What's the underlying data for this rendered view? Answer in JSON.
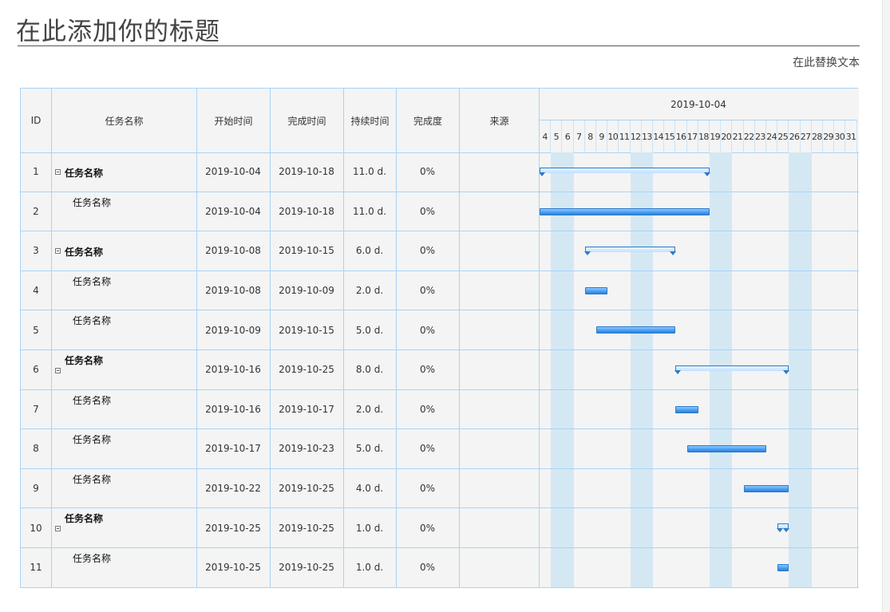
{
  "page": {
    "title": "在此添加你的标题",
    "subtitle": "在此替换文本"
  },
  "columns": {
    "id": "ID",
    "name": "任务名称",
    "start": "开始时间",
    "end": "完成时间",
    "duration": "持续时间",
    "progress": "完成度",
    "source": "来源"
  },
  "timeline": {
    "date": "2019-10-04",
    "days": [
      "4",
      "5",
      "6",
      "7",
      "8",
      "9",
      "10",
      "11",
      "12",
      "13",
      "14",
      "15",
      "16",
      "17",
      "18",
      "19",
      "20",
      "21",
      "22",
      "23",
      "24",
      "25",
      "26",
      "27",
      "28",
      "29",
      "30",
      "31"
    ]
  },
  "tasks": [
    {
      "id": "1",
      "name": "任务名称",
      "summary": true,
      "start": "2019-10-04",
      "end": "2019-10-18",
      "duration": "11.0 d.",
      "progress": "0%",
      "source": ""
    },
    {
      "id": "2",
      "name": "任务名称",
      "summary": false,
      "start": "2019-10-04",
      "end": "2019-10-18",
      "duration": "11.0 d.",
      "progress": "0%",
      "source": ""
    },
    {
      "id": "3",
      "name": "任务名称",
      "summary": true,
      "start": "2019-10-08",
      "end": "2019-10-15",
      "duration": "6.0 d.",
      "progress": "0%",
      "source": ""
    },
    {
      "id": "4",
      "name": "任务名称",
      "summary": false,
      "start": "2019-10-08",
      "end": "2019-10-09",
      "duration": "2.0 d.",
      "progress": "0%",
      "source": ""
    },
    {
      "id": "5",
      "name": "任务名称",
      "summary": false,
      "start": "2019-10-09",
      "end": "2019-10-15",
      "duration": "5.0 d.",
      "progress": "0%",
      "source": ""
    },
    {
      "id": "6",
      "name": "任务名称",
      "summary": true,
      "start": "2019-10-16",
      "end": "2019-10-25",
      "duration": "8.0 d.",
      "progress": "0%",
      "source": ""
    },
    {
      "id": "7",
      "name": "任务名称",
      "summary": false,
      "start": "2019-10-16",
      "end": "2019-10-17",
      "duration": "2.0 d.",
      "progress": "0%",
      "source": ""
    },
    {
      "id": "8",
      "name": "任务名称",
      "summary": false,
      "start": "2019-10-17",
      "end": "2019-10-23",
      "duration": "5.0 d.",
      "progress": "0%",
      "source": ""
    },
    {
      "id": "9",
      "name": "任务名称",
      "summary": false,
      "start": "2019-10-22",
      "end": "2019-10-25",
      "duration": "4.0 d.",
      "progress": "0%",
      "source": ""
    },
    {
      "id": "10",
      "name": "任务名称",
      "summary": true,
      "start": "2019-10-25",
      "end": "2019-10-25",
      "duration": "1.0 d.",
      "progress": "0%",
      "source": ""
    },
    {
      "id": "11",
      "name": "任务名称",
      "summary": false,
      "start": "2019-10-25",
      "end": "2019-10-25",
      "duration": "1.0 d.",
      "progress": "0%",
      "source": ""
    }
  ],
  "colors": {
    "grid_line": "#a8d3f5",
    "weekend_band": "#d4e8f4",
    "bar": "#4a9ff2",
    "bar_border": "#2c79c8"
  }
}
